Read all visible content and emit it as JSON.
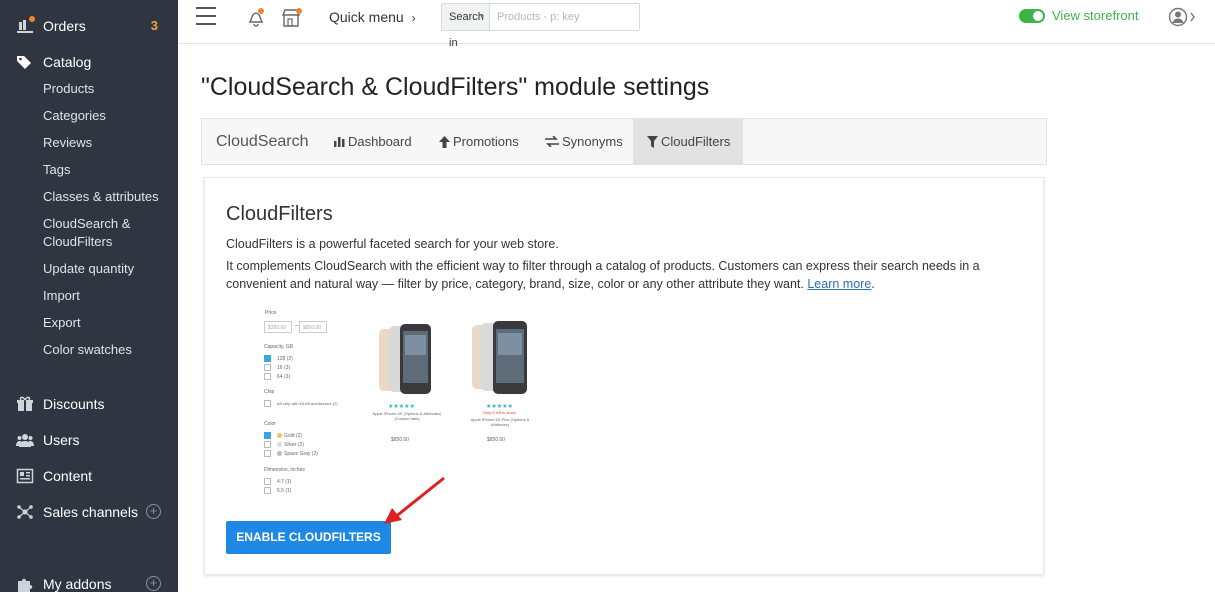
{
  "sidebar": {
    "items": [
      {
        "label": "Orders",
        "badge": "3"
      },
      {
        "label": "Catalog"
      },
      {
        "label": "Discounts"
      },
      {
        "label": "Users"
      },
      {
        "label": "Content"
      },
      {
        "label": "Sales channels"
      },
      {
        "label": "My addons"
      }
    ],
    "catalog_sub": [
      "Products",
      "Categories",
      "Reviews",
      "Tags",
      "Classes & attributes",
      "CloudSearch & CloudFilters",
      "Update quantity",
      "Import",
      "Export",
      "Color swatches"
    ]
  },
  "header": {
    "quick_menu": "Quick menu",
    "search_in": "Search in",
    "search_placeholder": "Products - p: key",
    "view_storefront": "View storefront"
  },
  "page": {
    "title": "\"CloudSearch & CloudFilters\" module settings",
    "tabs": {
      "brand": "CloudSearch",
      "dashboard": "Dashboard",
      "promotions": "Promotions",
      "synonyms": "Synonyms",
      "cloudfilters": "CloudFilters"
    },
    "card": {
      "title": "CloudFilters",
      "p1": "CloudFilters is a powerful faceted search for your web store.",
      "p2": "It complements CloudSearch with the efficient way to filter through a catalog of products. Customers can express their search needs in a convenient and natural way — filter by price, category, brand, size, color or any other attribute they want.",
      "learn_more": "Learn more",
      "button": "ENABLE CLOUDFILTERS"
    },
    "preview": {
      "price_label": "Price",
      "price_from": "$350.00",
      "price_to": "$850.00",
      "capacity_label": "Capacity, GB",
      "capacity_options": [
        "128 (2)",
        "16 (3)",
        "64 (3)"
      ],
      "chip_label": "Chip",
      "chip_option": "A9 chip with 64-bit architecture (2)",
      "color_label": "Color",
      "color_options": [
        "Gold (2)",
        "Silver (2)",
        "Space Gray (2)"
      ],
      "dimension_label": "Dimension, inches",
      "dimension_options": [
        "4.7 (1)",
        "5.5 (1)"
      ],
      "products": [
        {
          "name": "Apple iPhone 6S (Options & Attributes) (Custom tabs)",
          "stock": "",
          "price": "$850.00"
        },
        {
          "name": "Apple iPhone 6S Plus (Options & Attributes)",
          "stock": "Only 5 left in stock",
          "price": "$850.00"
        }
      ]
    }
  },
  "colors": {
    "sidebar_bg": "#2f3641",
    "accent": "#1f88e5",
    "badge": "#f7a13b",
    "storefront_green": "#3bb54a",
    "arrow": "#e02020"
  }
}
